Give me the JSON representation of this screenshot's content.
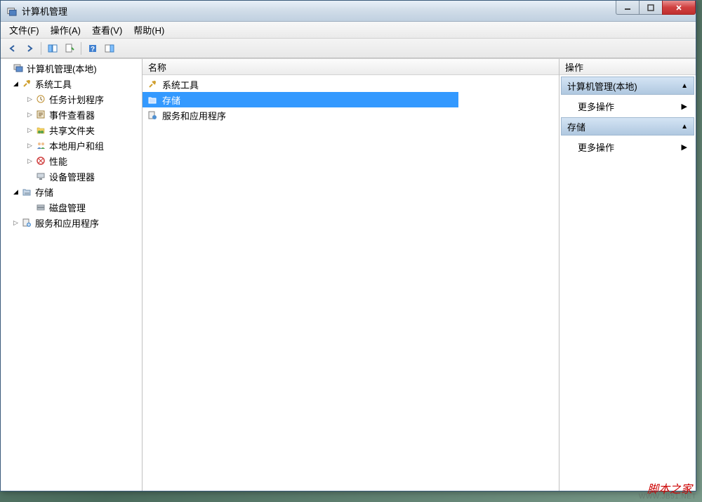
{
  "window": {
    "title": "计算机管理"
  },
  "menu": {
    "file": "文件(F)",
    "action": "操作(A)",
    "view": "查看(V)",
    "help": "帮助(H)"
  },
  "tree": {
    "root": "计算机管理(本地)",
    "system_tools": "系统工具",
    "task_scheduler": "任务计划程序",
    "event_viewer": "事件查看器",
    "shared_folders": "共享文件夹",
    "local_users": "本地用户和组",
    "performance": "性能",
    "device_manager": "设备管理器",
    "storage": "存储",
    "disk_management": "磁盘管理",
    "services_apps": "服务和应用程序"
  },
  "list": {
    "header_name": "名称",
    "items": [
      {
        "label": "系统工具"
      },
      {
        "label": "存储"
      },
      {
        "label": "服务和应用程序"
      }
    ],
    "selected_index": 1
  },
  "actions": {
    "header": "操作",
    "sections": [
      {
        "title": "计算机管理(本地)",
        "items": [
          "更多操作"
        ]
      },
      {
        "title": "存储",
        "items": [
          "更多操作"
        ]
      }
    ]
  },
  "watermark": "脚本之家"
}
